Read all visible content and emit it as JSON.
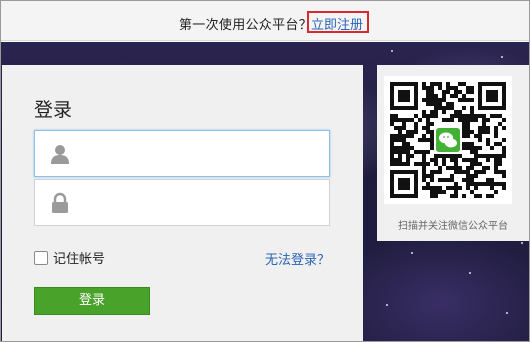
{
  "header": {
    "prompt": "第一次使用公众平台？",
    "register_label": "立即注册"
  },
  "login": {
    "title": "登录",
    "username_placeholder": "",
    "password_placeholder": "",
    "remember_label": "记住帐号",
    "forgot_label": "无法登录？",
    "submit_label": "登录"
  },
  "qr": {
    "caption": "扫描并关注微信公众平台",
    "center_icon": "wechat-icon"
  },
  "colors": {
    "link": "#2a64b8",
    "button": "#49a22a",
    "highlight_box": "#d9282e",
    "background": "#231f45"
  },
  "icons": [
    "user-icon",
    "lock-icon",
    "checkbox",
    "qr-code",
    "wechat-icon"
  ]
}
